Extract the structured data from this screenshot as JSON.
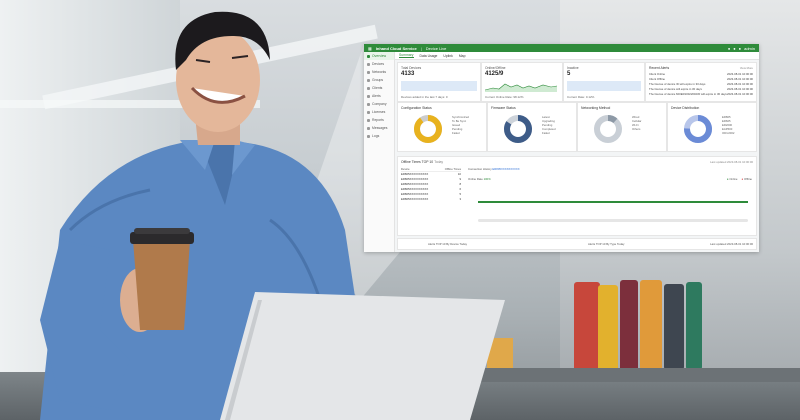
{
  "app": {
    "title": "Inhand Cloud Service",
    "product": "Device Live",
    "user": "admin"
  },
  "nav": {
    "items": [
      {
        "label": "Overview"
      },
      {
        "label": "Devices"
      },
      {
        "label": "Networks"
      },
      {
        "label": "Groups"
      },
      {
        "label": "Clients"
      },
      {
        "label": "Alerts"
      },
      {
        "label": "Company"
      },
      {
        "label": "Licenses"
      },
      {
        "label": "Reports"
      },
      {
        "label": "Messages"
      },
      {
        "label": "Logs"
      }
    ]
  },
  "tabs": [
    {
      "label": "Summary"
    },
    {
      "label": "Data Usage"
    },
    {
      "label": "Uplink"
    },
    {
      "label": "Map"
    }
  ],
  "kpis": [
    {
      "label": "Total Devices",
      "value": "4133",
      "sub": "Devices added in the last 7 days: 0"
    },
    {
      "label": "Online/Offline",
      "value": "4125/9",
      "sub": "Current Online Rate: 98.12%"
    },
    {
      "label": "Inactive",
      "value": "5",
      "sub": "Current Rate: 0.12%"
    }
  ],
  "alerts": {
    "title": "Recent Alerts",
    "more": "View More",
    "rows": [
      {
        "text": "Client Online",
        "time": "2023-08-01 10:00:00"
      },
      {
        "text": "Client Offline",
        "time": "2023-08-01 10:00:00"
      },
      {
        "text": "The license of device ID will expire in 30 days",
        "time": "2023-08-01 10:00:00"
      },
      {
        "text": "The license of device will expire in 30 days",
        "time": "2023-08-01 10:00:00"
      },
      {
        "text": "The license of device 600ER1002200230 will expire in 30 days",
        "time": "2023-08-01 10:00:00"
      }
    ]
  },
  "donuts": [
    {
      "title": "Configuration Status",
      "legend": [
        "Synchronized",
        "To Be Sync",
        "Issued",
        "Pending",
        "Failed"
      ],
      "colors": [
        "#e8b21e",
        "#cccccc"
      ]
    },
    {
      "title": "Firmware Status",
      "legend": [
        "Latest",
        "Upgrading",
        "Pending",
        "Completed",
        "Failed"
      ],
      "colors": [
        "#3e5c88",
        "#cdd3da"
      ]
    },
    {
      "title": "Networking Method",
      "legend": [
        "Wired",
        "Cellular",
        "Wi-Fi",
        "Others"
      ],
      "colors": [
        "#c9cfd6",
        "#8d99a6"
      ]
    },
    {
      "title": "Device Distribution",
      "legend": [
        "ER805",
        "ER605",
        "ER2000",
        "EAP600",
        "ODU2002"
      ],
      "colors": [
        "#6b8bd6",
        "#b8c6ea"
      ]
    }
  ],
  "offline": {
    "title": "Offline Times TOP 10",
    "period": "Today",
    "updated": "Last updated 2023-08-01 10:00:00",
    "col_device": "Device",
    "col_times": "Offline Times",
    "history_label": "Connection History",
    "history_link": "ER805XXXXXXXXXX",
    "online_rate_label": "Online Rate",
    "online_rate": "100%",
    "legend_online": "Online",
    "legend_offline": "Offline",
    "rows": [
      {
        "device": "ER805XXXXXXXXXX",
        "times": "10"
      },
      {
        "device": "ER805XXXXXXXXXX",
        "times": "9"
      },
      {
        "device": "ER805XXXXXXXXXX",
        "times": "8"
      },
      {
        "device": "ER805XXXXXXXXXX",
        "times": "6"
      },
      {
        "device": "ER805XXXXXXXXXX",
        "times": "5"
      },
      {
        "device": "ER805XXXXXXXXXX",
        "times": "3"
      }
    ]
  },
  "footer": {
    "left": "Alerts TOP 10 By Device",
    "left_period": "Today",
    "mid": "Alerts TOP 10 By Type",
    "mid_period": "Today",
    "updated": "Last updated 2023-08-01 10:00:00"
  },
  "colors": {
    "brand": "#2e8b3a",
    "shirt": "#5b88c2",
    "laptop": "#e4e6e8"
  }
}
